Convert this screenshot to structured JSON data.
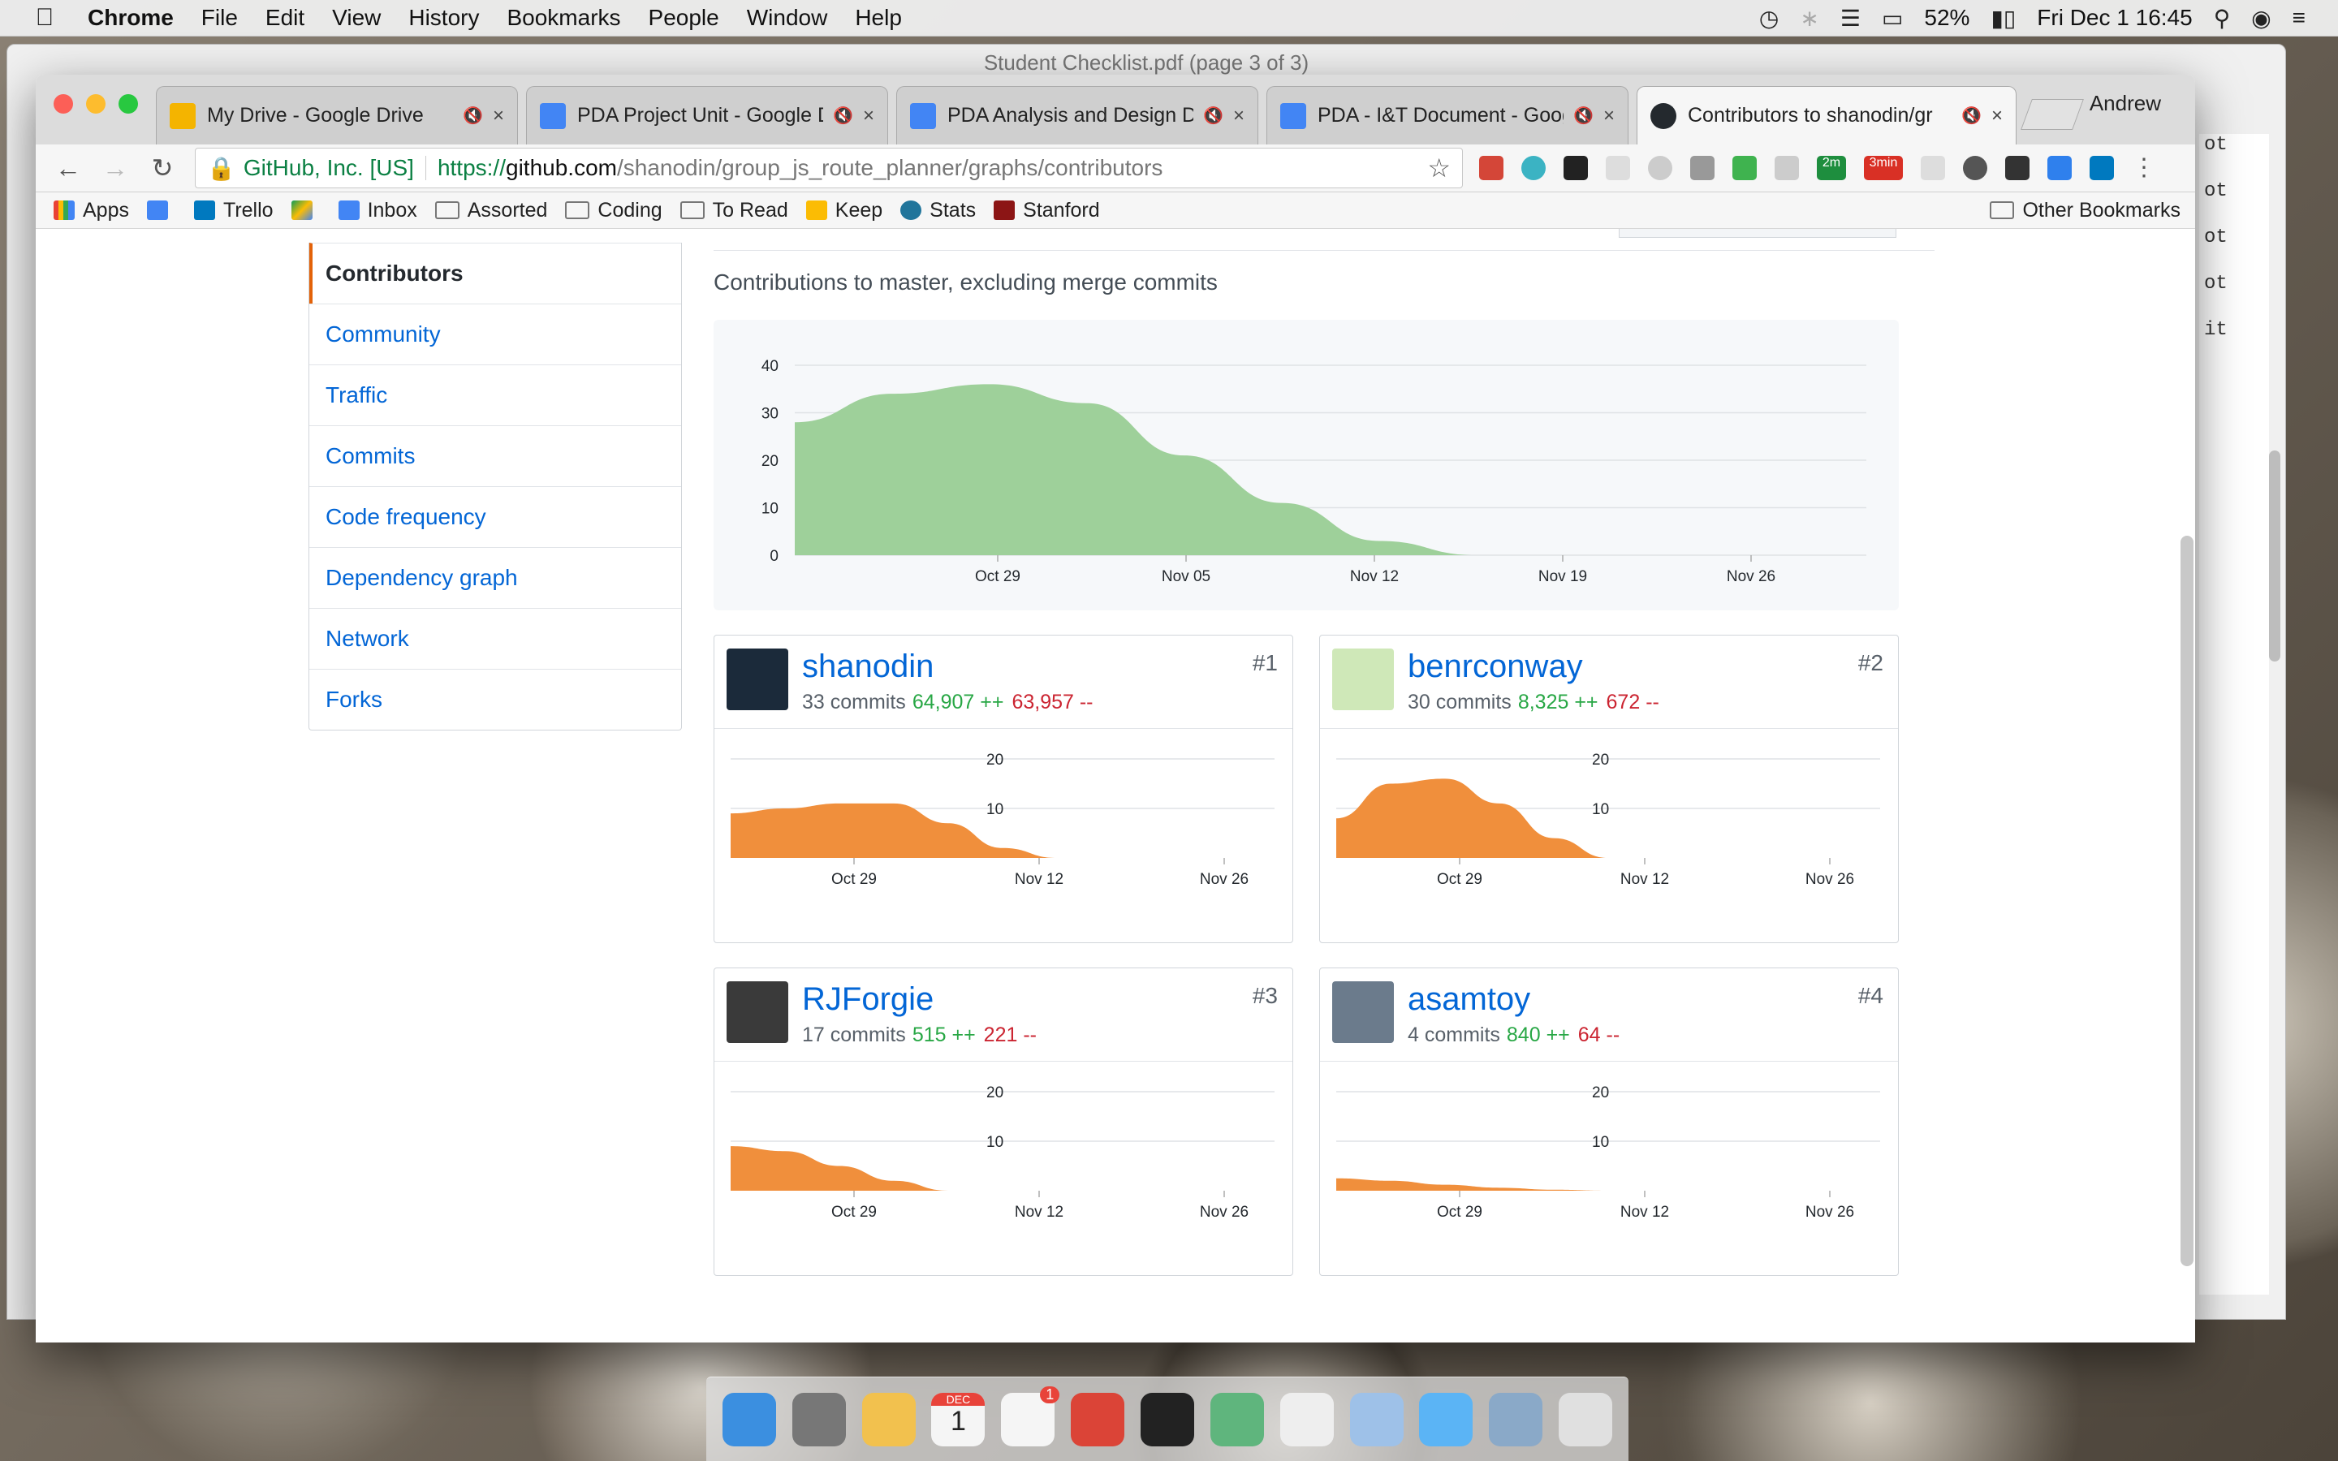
{
  "menubar": {
    "app": "Chrome",
    "items": [
      "File",
      "Edit",
      "View",
      "History",
      "Bookmarks",
      "People",
      "Window",
      "Help"
    ],
    "battery": "52%",
    "clock": "Fri Dec 1  16:45"
  },
  "back_window": {
    "title": "Student Checklist.pdf (page 3 of 3)",
    "lines": [
      "ot",
      "ot",
      "ot",
      "ot",
      "it"
    ]
  },
  "browser": {
    "tabs": [
      {
        "title": "My Drive - Google Drive",
        "color": "#f4b400"
      },
      {
        "title": "PDA Project Unit - Google D",
        "color": "#4285f4"
      },
      {
        "title": "PDA Analysis and Design Do",
        "color": "#4285f4"
      },
      {
        "title": "PDA - I&T Document - Goog",
        "color": "#4285f4"
      },
      {
        "title": "Contributors to shanodin/gr",
        "color": "#24292e"
      }
    ],
    "profile": "Andrew",
    "url": {
      "org": "GitHub, Inc. [US]",
      "protocol": "https://",
      "host": "github.com",
      "path": "/shanodin/group_js_route_planner/graphs/contributors"
    },
    "bookmarks": [
      "Apps",
      "Trello",
      "Inbox",
      "Assorted",
      "Coding",
      "To Read",
      "Keep",
      "Stats",
      "Stanford"
    ],
    "other_bookmarks": "Other Bookmarks",
    "ext_badges": [
      "2m",
      "3min"
    ]
  },
  "sidebar": [
    {
      "label": "Contributors",
      "active": true
    },
    {
      "label": "Community"
    },
    {
      "label": "Traffic"
    },
    {
      "label": "Commits"
    },
    {
      "label": "Code frequency"
    },
    {
      "label": "Dependency graph"
    },
    {
      "label": "Network"
    },
    {
      "label": "Forks"
    }
  ],
  "subtitle": "Contributions to master, excluding merge commits",
  "chart_data": [
    {
      "type": "area",
      "title": "",
      "color": "#9ed09a",
      "x": [
        "Oct 22",
        "Oct 25",
        "Oct 29",
        "Nov 01",
        "Nov 05",
        "Nov 08",
        "Nov 12",
        "Nov 15",
        "Nov 19",
        "Nov 22",
        "Nov 26",
        "Nov 30"
      ],
      "values": [
        28,
        34,
        36,
        32,
        21,
        11,
        3,
        0,
        0,
        0,
        0,
        0
      ],
      "x_ticks": [
        "Oct 29",
        "Nov 05",
        "Nov 12",
        "Nov 19",
        "Nov 26"
      ],
      "y_ticks": [
        0,
        10,
        20,
        30,
        40
      ],
      "ylim": [
        0,
        40
      ]
    },
    {
      "type": "area",
      "series": [
        {
          "name": "shanodin"
        }
      ],
      "color": "#f08f3c",
      "values": [
        9,
        10,
        11,
        11,
        7,
        2,
        0,
        0,
        0,
        0,
        0
      ],
      "x_ticks": [
        "Oct 29",
        "Nov 12",
        "Nov 26"
      ],
      "y_ticks": [
        10,
        20
      ],
      "ylim": [
        0,
        20
      ]
    },
    {
      "type": "area",
      "series": [
        {
          "name": "benrconway"
        }
      ],
      "color": "#f08f3c",
      "values": [
        8,
        15,
        16,
        11,
        4,
        0,
        0,
        0,
        0,
        0,
        0
      ],
      "x_ticks": [
        "Oct 29",
        "Nov 12",
        "Nov 26"
      ],
      "y_ticks": [
        10,
        20
      ],
      "ylim": [
        0,
        20
      ]
    },
    {
      "type": "area",
      "series": [
        {
          "name": "RJForgie"
        }
      ],
      "color": "#f08f3c",
      "values": [
        9,
        8,
        5,
        2,
        0,
        0,
        0,
        0,
        0,
        0,
        0
      ],
      "x_ticks": [
        "Oct 29",
        "Nov 12",
        "Nov 26"
      ],
      "y_ticks": [
        10,
        20
      ],
      "ylim": [
        0,
        20
      ]
    },
    {
      "type": "area",
      "series": [
        {
          "name": "asamtoy"
        }
      ],
      "color": "#f08f3c",
      "values": [
        2.5,
        2,
        1.2,
        0.6,
        0.2,
        0,
        0,
        0,
        0,
        0,
        0
      ],
      "x_ticks": [
        "Oct 29",
        "Nov 12",
        "Nov 26"
      ],
      "y_ticks": [
        10,
        20
      ],
      "ylim": [
        0,
        20
      ]
    }
  ],
  "contributors": [
    {
      "rank": "#1",
      "name": "shanodin",
      "commits": "33 commits",
      "additions": "64,907 ++",
      "deletions": "63,957 --",
      "avatar_color": "#1b2a3a"
    },
    {
      "rank": "#2",
      "name": "benrconway",
      "commits": "30 commits",
      "additions": "8,325 ++",
      "deletions": "672 --",
      "avatar_color": "#cfe8b8"
    },
    {
      "rank": "#3",
      "name": "RJForgie",
      "commits": "17 commits",
      "additions": "515 ++",
      "deletions": "221 --",
      "avatar_color": "#3a3a3a"
    },
    {
      "rank": "#4",
      "name": "asamtoy",
      "commits": "4 commits",
      "additions": "840 ++",
      "deletions": "64 --",
      "avatar_color": "#6b7b8c"
    }
  ],
  "dock": [
    {
      "name": "finder-icon",
      "color": "#3b8fe0"
    },
    {
      "name": "system-preferences-icon",
      "color": "#777"
    },
    {
      "name": "textedit-icon",
      "color": "#f2c14e"
    },
    {
      "name": "calendar-icon",
      "color": "#f5f5f5"
    },
    {
      "name": "reminders-icon",
      "color": "#f5f5f5"
    },
    {
      "name": "chrome-icon",
      "color": "#db4437"
    },
    {
      "name": "terminal-icon",
      "color": "#222"
    },
    {
      "name": "atom-icon",
      "color": "#5fb57d"
    },
    {
      "name": "slack-icon",
      "color": "#eee"
    },
    {
      "name": "preview-icon",
      "color": "#9ec1e8"
    },
    {
      "name": "messages-icon",
      "color": "#5bb4f5"
    },
    {
      "name": "photos-icon",
      "color": "#8aa9c8"
    },
    {
      "name": "trash-icon",
      "color": "#e0e0e0"
    }
  ],
  "dock_labels": {
    "calendar_month": "DEC",
    "calendar_day": "1",
    "reminders_badge": "1"
  }
}
